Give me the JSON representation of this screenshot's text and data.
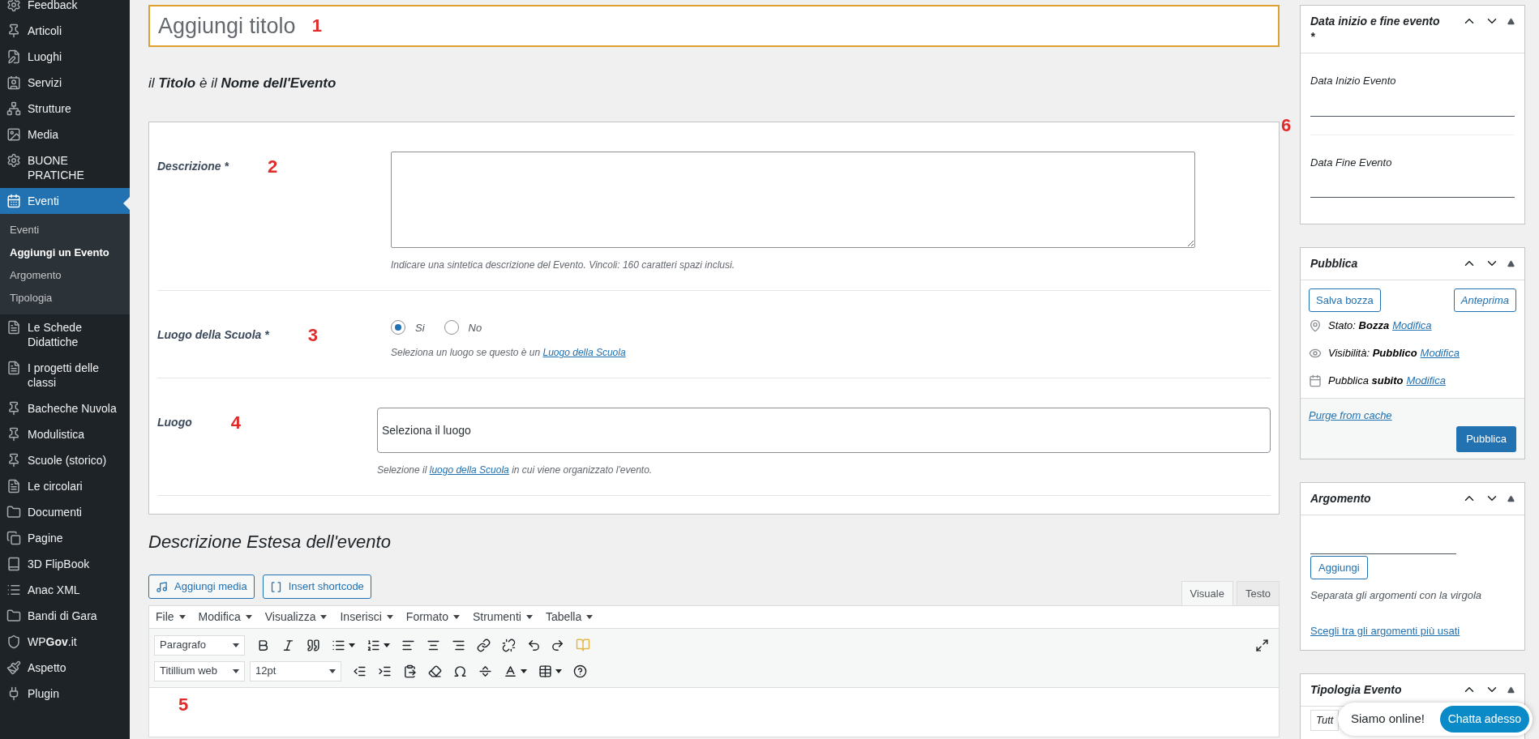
{
  "sidebar": {
    "items": [
      {
        "label": "Feedback",
        "selected": false
      },
      {
        "label": "Articoli",
        "selected": false
      },
      {
        "label": "Luoghi",
        "selected": false
      },
      {
        "label": "Servizi",
        "selected": false
      },
      {
        "label": "Strutture",
        "selected": false
      },
      {
        "label": "Media",
        "selected": false
      },
      {
        "label": "BUONE PRATICHE",
        "selected": false
      },
      {
        "label": "Eventi",
        "selected": true,
        "children": [
          {
            "label": "Eventi",
            "selected": false
          },
          {
            "label": "Aggiungi un Evento",
            "selected": true
          },
          {
            "label": "Argomento",
            "selected": false
          },
          {
            "label": "Tipologia",
            "selected": false
          }
        ]
      },
      {
        "label": "Le Schede Didattiche",
        "selected": false
      },
      {
        "label": "I progetti delle classi",
        "selected": false
      },
      {
        "label": "Bacheche Nuvola",
        "selected": false
      },
      {
        "label": "Modulistica",
        "selected": false
      },
      {
        "label": "Scuole (storico)",
        "selected": false
      },
      {
        "label": "Le circolari",
        "selected": false
      },
      {
        "label": "Documenti",
        "selected": false
      },
      {
        "label": "Pagine",
        "selected": false
      },
      {
        "label": "3D FlipBook",
        "selected": false
      },
      {
        "label": "Anac XML",
        "selected": false
      },
      {
        "label": "Bandi di Gara",
        "selected": false
      },
      {
        "label": "WP**Gov**.it",
        "selected": false
      },
      {
        "label": "Aspetto",
        "selected": false
      },
      {
        "label": "Plugin",
        "selected": false
      }
    ]
  },
  "title_field": {
    "placeholder": "Aggiungi titolo",
    "annotation": "1"
  },
  "title_hint": "il **Titolo** è il **Nome dell'Evento**",
  "form": {
    "annotation": "6",
    "rows": [
      {
        "kind": "textarea",
        "label": "Descrizione *",
        "annotation": "2",
        "help": "Indicare una sintetica descrizione del Evento. Vincoli: 160 caratteri spazi inclusi."
      },
      {
        "kind": "radio",
        "label": "Luogo della Scuola *",
        "annotation": "3",
        "options": [
          {
            "label": "Si",
            "selected": true
          },
          {
            "label": "No",
            "selected": false
          }
        ],
        "help_before": "Seleziona un luogo se questo è un",
        "help_link": "Luogo della Scuola",
        "help_after": ""
      },
      {
        "kind": "select",
        "label": "Luogo",
        "annotation": "4",
        "value": "Seleziona il luogo",
        "help_before": "Selezione il",
        "help_link": "luogo della Scuola",
        "help_after": "in cui viene organizzato l'evento."
      }
    ]
  },
  "editor": {
    "heading": "Descrizione Estesa dell'evento",
    "annotation": "5",
    "media_buttons": [
      "Aggiungi media",
      "Insert shortcode"
    ],
    "tabs": [
      {
        "label": "Visuale",
        "selected": true
      },
      {
        "label": "Testo",
        "selected": false
      }
    ],
    "menu": [
      "File",
      "Modifica",
      "Visualizza",
      "Inserisci",
      "Formato",
      "Strumenti",
      "Tabella"
    ],
    "format_select": "Paragrafo",
    "font_select": "Titillium web",
    "size_select": "12pt"
  },
  "boxes": [
    {
      "kind": "dates",
      "title": "Data inizio e fine evento *",
      "fields": [
        "Data Inizio Evento",
        "Data Fine Evento"
      ]
    },
    {
      "kind": "publish",
      "title": "Pubblica",
      "save": "Salva bozza",
      "preview": "Anteprima",
      "rows": [
        {
          "text": "Stato: **Bozza**",
          "link": "Modifica"
        },
        {
          "text": "Visibilità: **Pubblico**",
          "link": "Modifica"
        },
        {
          "text": "Pubblica **subito**",
          "link": "Modifica"
        }
      ],
      "purge": "Purge from cache",
      "publish": "Pubblica"
    },
    {
      "kind": "tags",
      "title": "Argomento",
      "add": "Aggiungi",
      "hint": "Separata gli argomenti con la virgola",
      "link": "Scegli tra gli argomenti più usati"
    },
    {
      "kind": "categories",
      "title": "Tipologia Evento",
      "tab": "Tutt"
    }
  ],
  "chat": {
    "text": "Siamo online!",
    "button": "Chatta adesso"
  }
}
